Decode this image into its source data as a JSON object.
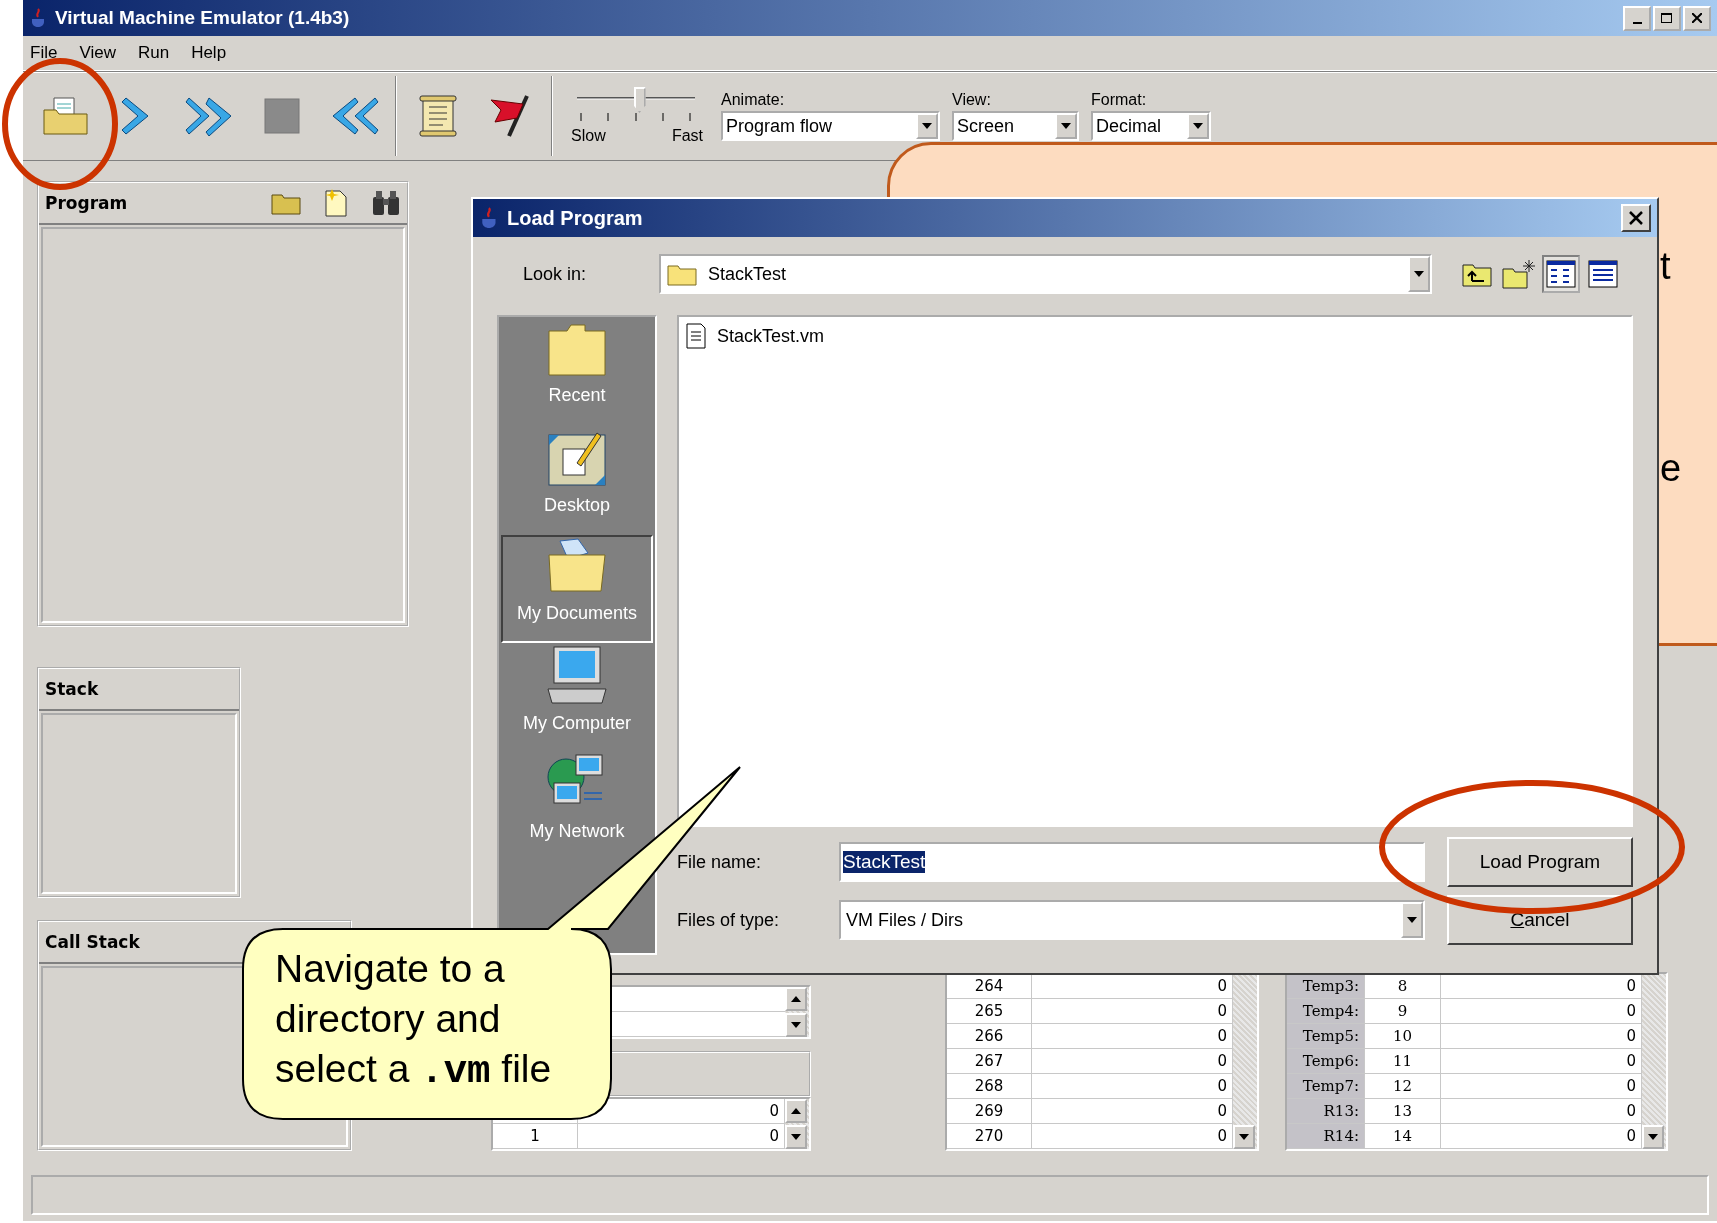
{
  "window": {
    "title": "Virtual Machine Emulator (1.4b3)"
  },
  "menu": [
    "File",
    "View",
    "Run",
    "Help"
  ],
  "toolbar": {
    "buttons": [
      {
        "kind": "load"
      },
      {
        "kind": "step"
      },
      {
        "kind": "run"
      },
      {
        "kind": "stop"
      },
      {
        "kind": "reset"
      },
      {
        "kind": "separator"
      },
      {
        "kind": "script"
      },
      {
        "kind": "breakpoints"
      },
      {
        "kind": "separator"
      }
    ],
    "speed": {
      "level": 0.53,
      "min_label": "Slow",
      "max_label": "Fast"
    },
    "dropdowns": [
      {
        "label": "Animate:",
        "value": "Program flow"
      },
      {
        "label": "View:",
        "value": "Screen"
      },
      {
        "label": "Format:",
        "value": "Decimal"
      }
    ]
  },
  "panels": {
    "program": {
      "title": "Program"
    },
    "stack": {
      "title": "Stack"
    },
    "call_stack": {
      "title": "Call Stack"
    }
  },
  "middle_table": {
    "rows": [
      {
        "value": "0"
      },
      {
        "address": "1",
        "value": "0"
      }
    ]
  },
  "ram_table": {
    "rows": [
      {
        "address": "264",
        "value": "0"
      },
      {
        "address": "265",
        "value": "0"
      },
      {
        "address": "266",
        "value": "0"
      },
      {
        "address": "267",
        "value": "0"
      },
      {
        "address": "268",
        "value": "0"
      },
      {
        "address": "269",
        "value": "0"
      },
      {
        "address": "270",
        "value": "0"
      }
    ]
  },
  "registers_table": {
    "rows": [
      {
        "name": "Temp3:",
        "index": "8",
        "value": "0"
      },
      {
        "name": "Temp4:",
        "index": "9",
        "value": "0"
      },
      {
        "name": "Temp5:",
        "index": "10",
        "value": "0"
      },
      {
        "name": "Temp6:",
        "index": "11",
        "value": "0"
      },
      {
        "name": "Temp7:",
        "index": "12",
        "value": "0"
      },
      {
        "name": "R13:",
        "index": "13",
        "value": "0"
      },
      {
        "name": "R14:",
        "index": "14",
        "value": "0"
      }
    ]
  },
  "dialog": {
    "title": "Load Program",
    "look_in_label": "Look in:",
    "look_in_value": "StackTest",
    "views": [
      {
        "kind": "list",
        "selected": true
      },
      {
        "kind": "details",
        "selected": false
      }
    ],
    "places": [
      {
        "kind": "recent",
        "label": "Recent",
        "selected": false
      },
      {
        "kind": "desktop",
        "label": "Desktop",
        "selected": false
      },
      {
        "kind": "documents",
        "label": "My Documents",
        "selected": true
      },
      {
        "kind": "computer",
        "label": "My Computer",
        "selected": false
      },
      {
        "kind": "network",
        "label": "My Network",
        "selected": false
      }
    ],
    "files": [
      {
        "name": "StackTest.vm"
      }
    ],
    "file_name_label": "File name:",
    "file_name": "StackTest",
    "file_name_selected": true,
    "file_type_label": "Files of type:",
    "file_type": "VM Files / Dirs",
    "buttons": [
      {
        "label": "Load Program",
        "mnemonic_underlined": false
      },
      {
        "label": "Cancel",
        "mnemonic_underlined": true
      }
    ]
  },
  "callout": {
    "parts": [
      {
        "kind": "plain",
        "text": "Navigate to a directory and select a "
      },
      {
        "kind": "code",
        "text": ".vm"
      },
      {
        "kind": "plain",
        "text": " file"
      }
    ]
  },
  "background_callout": {
    "visible_letters": [
      "t",
      "e"
    ]
  }
}
